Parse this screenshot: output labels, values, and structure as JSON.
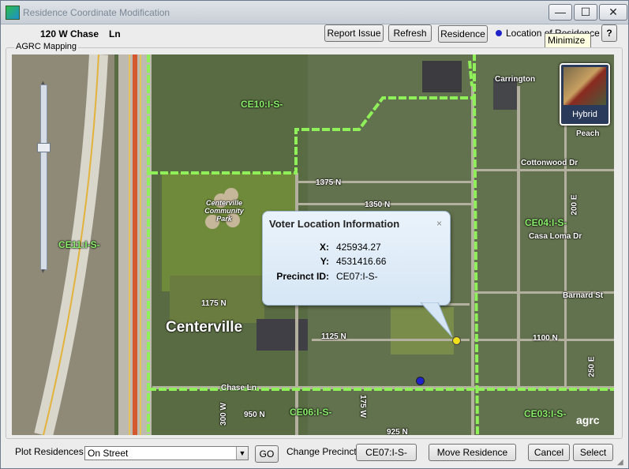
{
  "window": {
    "title": "Residence Coordinate Modification",
    "minimize_symbol": "—",
    "maximize_symbol": "☐",
    "close_symbol": "✕"
  },
  "header": {
    "street_number_name": "120 W Chase",
    "street_type": "Ln",
    "report_issue_label": "Report Issue",
    "refresh_label": "Refresh",
    "residence_label": "Residence",
    "legend_text": "Location of Residence",
    "help_label": "?",
    "tooltip_text": "Minimize"
  },
  "group": {
    "label": "AGRC Mapping"
  },
  "map": {
    "hybrid_label": "Hybrid",
    "attribution": "agrc",
    "labels": {
      "ce10": "CE10:I-S-",
      "ce11": "CE11:I-S-",
      "ce04": "CE04:I-S-",
      "ce06": "CE06:I-S-",
      "ce03": "CE03:I-S-",
      "park": "Centerville\nCommunity\nPark",
      "city": "Centerville",
      "carrington": "Carrington",
      "cottonwood": "Cottonwood Dr",
      "casa_loma": "Casa Loma Dr",
      "barnard": "Barnard St",
      "n1375": "1375 N",
      "n1350": "1350 N",
      "n1175": "1175 N",
      "n1125": "1125 N",
      "n1100": "1100 N",
      "n950": "950 N",
      "n925": "925 N",
      "chase": "Chase Ln",
      "w300": "300 W",
      "w175": "175 W",
      "e200": "200 E",
      "e250": "250 E",
      "peach": "Peach"
    },
    "popup": {
      "title": "Voter Location Information",
      "close": "×",
      "x_label": "X:",
      "x_value": "425934.27",
      "y_label": "Y:",
      "y_value": "4531416.66",
      "precinct_label": "Precinct ID:",
      "precinct_value": "CE07:I-S-"
    },
    "colors": {
      "precinct_boundary": "#8ff05a",
      "residence_pin": "#1e22c8",
      "voter_pin": "#f1e11a"
    }
  },
  "footer": {
    "plot_label": "Plot Residences",
    "plot_value": "On Street",
    "go_label": "GO",
    "change_precinct_label": "Change Precinct",
    "precinct_button_label": "CE07:I-S-",
    "move_residence_label": "Move Residence",
    "cancel_label": "Cancel",
    "select_label": "Select"
  }
}
